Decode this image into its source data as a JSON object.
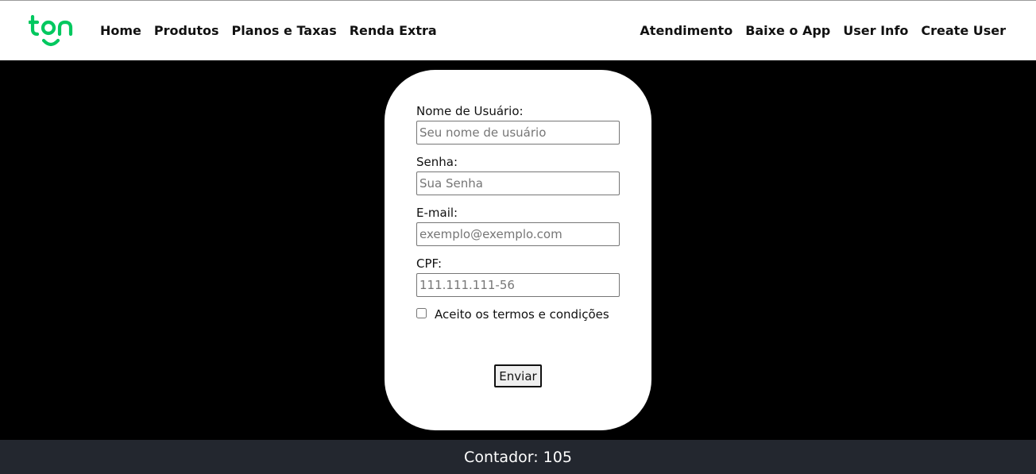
{
  "colors": {
    "brand_green": "#00c85f",
    "navbar_bg": "#ffffff",
    "page_bg": "#000000",
    "card_bg": "#ffffff",
    "footer_bg": "#23272f",
    "footer_text": "#ffffff"
  },
  "header": {
    "logo_text": "ton",
    "nav_left": [
      {
        "label": "Home"
      },
      {
        "label": "Produtos"
      },
      {
        "label": "Planos e Taxas"
      },
      {
        "label": "Renda Extra"
      }
    ],
    "nav_right": [
      {
        "label": "Atendimento"
      },
      {
        "label": "Baixe o App"
      },
      {
        "label": "User Info"
      },
      {
        "label": "Create User"
      }
    ]
  },
  "form": {
    "username": {
      "label": "Nome de Usuário:",
      "placeholder": "Seu nome de usuário",
      "value": ""
    },
    "password": {
      "label": "Senha:",
      "placeholder": "Sua Senha",
      "value": ""
    },
    "email": {
      "label": "E-mail:",
      "placeholder": "exemplo@exemplo.com",
      "value": ""
    },
    "cpf": {
      "label": "CPF:",
      "placeholder": "111.111.111-56",
      "value": ""
    },
    "terms": {
      "label": "Aceito os termos e condições",
      "checked": false
    },
    "submit_label": "Enviar"
  },
  "footer": {
    "counter_text": "Contador: 105"
  }
}
